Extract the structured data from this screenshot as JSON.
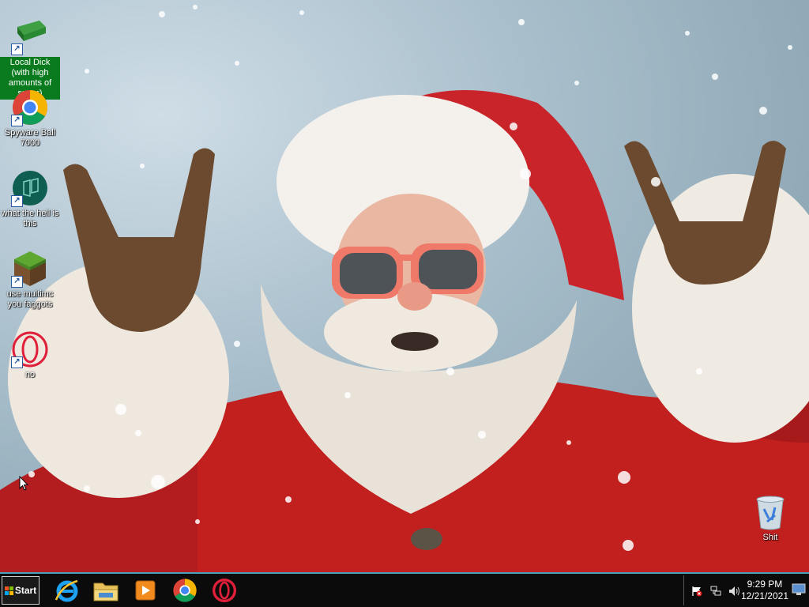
{
  "desktop": {
    "icons": [
      {
        "label": "Local Dick (with high amounts of sugar)",
        "icon": "book-icon",
        "selected": true
      },
      {
        "label": "Spyware Ball 7000",
        "icon": "chrome-icon"
      },
      {
        "label": "what the hell is this",
        "icon": "edge-icon"
      },
      {
        "label": "use multimc you faggots",
        "icon": "minecraft-icon"
      },
      {
        "label": "no",
        "icon": "opera-icon"
      }
    ],
    "recycle_bin": {
      "label": "Shit",
      "icon": "recycle-bin-icon"
    }
  },
  "taskbar": {
    "start_label": "Start",
    "pinned": [
      "ie-icon",
      "file-explorer-icon",
      "media-player-icon",
      "chrome-icon",
      "opera-icon"
    ],
    "tray": {
      "time": "9:29 PM",
      "date": "12/21/2021",
      "icons": [
        "action-center-flag-icon",
        "network-icon",
        "volume-icon",
        "show-desktop-icon"
      ]
    }
  },
  "colors": {
    "selection_green": "#0a7a1e",
    "taskbar_bg": "#0b0b0b",
    "taskbar_border": "#4a9ec0"
  }
}
